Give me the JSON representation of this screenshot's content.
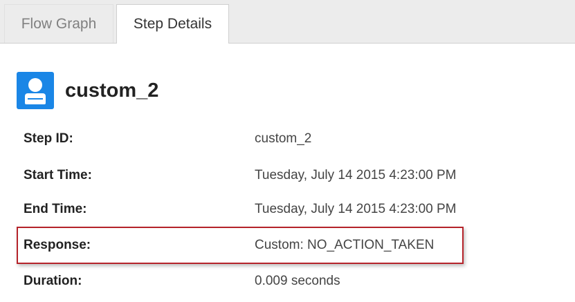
{
  "tabs": {
    "flow_graph": "Flow Graph",
    "step_details": "Step Details"
  },
  "step": {
    "icon": "person-card-icon",
    "name": "custom_2"
  },
  "details": {
    "step_id": {
      "label": "Step ID:",
      "value": "custom_2"
    },
    "start_time": {
      "label": "Start Time:",
      "value": "Tuesday, July 14 2015 4:23:00 PM"
    },
    "end_time": {
      "label": "End Time:",
      "value": "Tuesday, July 14 2015 4:23:00 PM"
    },
    "response": {
      "label": "Response:",
      "value": "Custom: NO_ACTION_TAKEN"
    },
    "duration": {
      "label": "Duration:",
      "value": "0.009 seconds"
    }
  },
  "colors": {
    "icon_accent": "#1a86e6",
    "highlight_border": "#b5232a"
  }
}
